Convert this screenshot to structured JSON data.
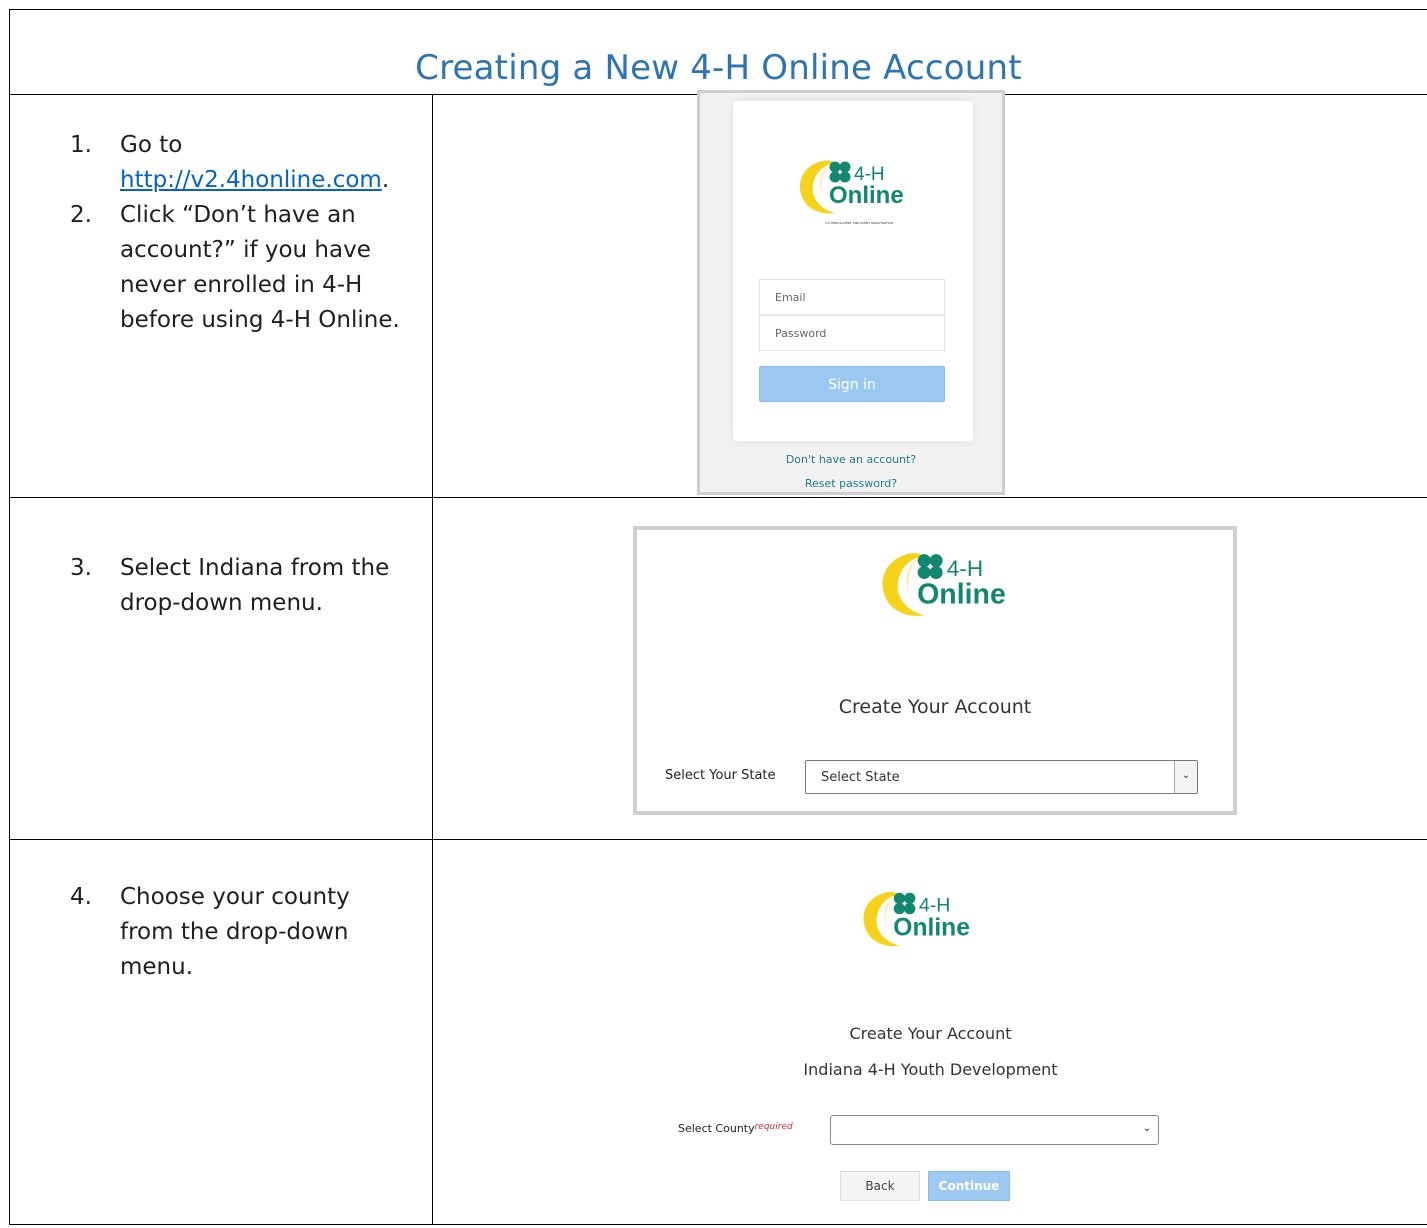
{
  "title": "Creating a New 4-H Online Account",
  "colors": {
    "title": "#2e74b5",
    "link": "#0563c1",
    "brand_green": "#12876f",
    "brand_yellow": "#f5d31a",
    "button_blue": "#9bc8f0"
  },
  "logo": {
    "brand": "4-H",
    "product": "Online",
    "tagline": "4-H ENROLLMENT AND EVENT REGISTRATION"
  },
  "row1": {
    "step1_num": "1.",
    "step1_text": "Go to",
    "step1_link": "http://v2.4honline.com",
    "step1_end": ".",
    "step2_num": "2.",
    "step2_text": "Click “Don’t have an account?” if you have never enrolled in 4-H before using 4-H Online.",
    "shot": {
      "email_placeholder": "Email",
      "password_placeholder": "Password",
      "signin_label": "Sign in",
      "no_account_link": "Don't have an account?",
      "reset_link": "Reset password?"
    }
  },
  "row2": {
    "step_num": "3.",
    "step_text": "Select Indiana from the drop-down menu.",
    "shot": {
      "heading": "Create Your Account",
      "state_label": "Select Your State",
      "state_value": "Select State"
    }
  },
  "row3": {
    "step_num": "4.",
    "step_text": "Choose your county from the drop-down menu.",
    "shot": {
      "heading": "Create Your Account",
      "org": "Indiana 4-H Youth Development",
      "county_label": "Select County",
      "required": "required",
      "county_value": "",
      "back_label": "Back",
      "continue_label": "Continue"
    }
  }
}
